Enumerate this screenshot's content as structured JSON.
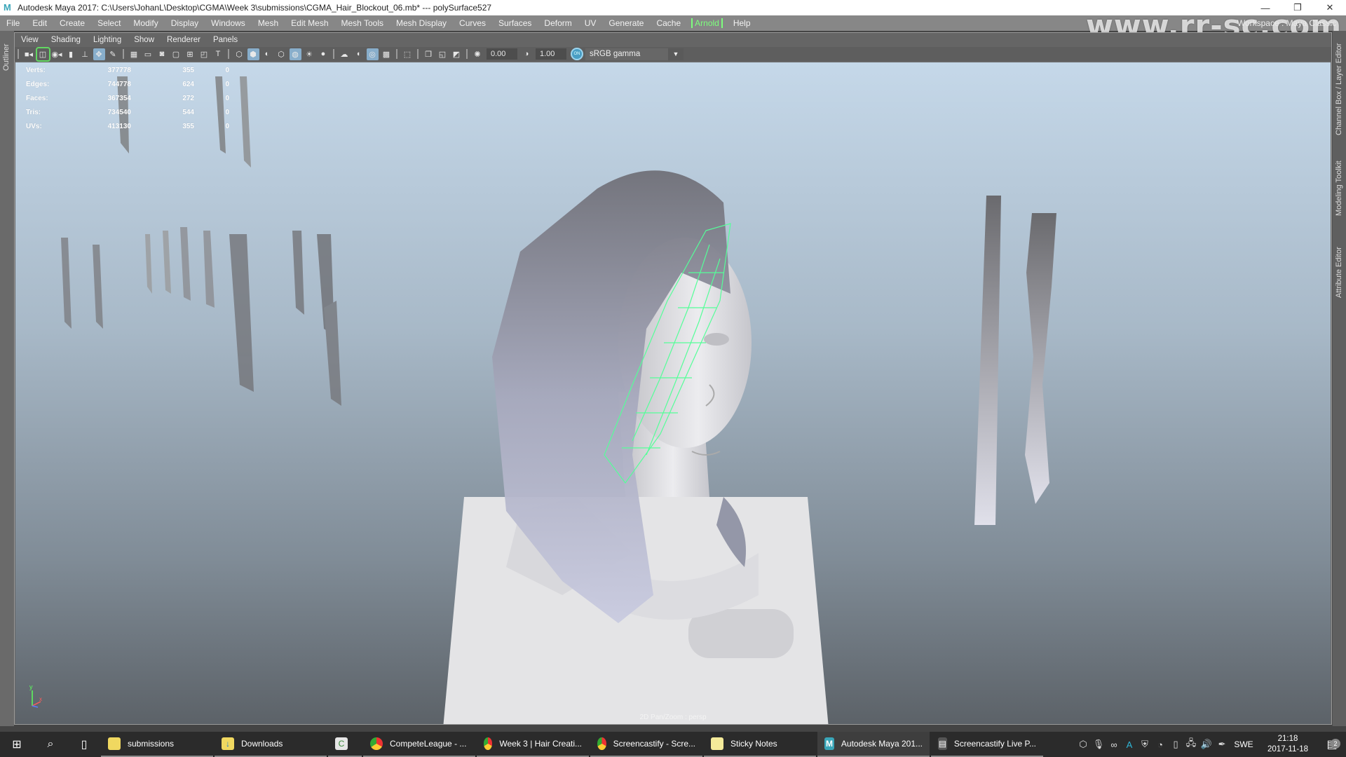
{
  "window": {
    "app_icon": "M",
    "title": "Autodesk Maya 2017: C:\\Users\\JohanL\\Desktop\\CGMA\\Week 3\\submissions\\CGMA_Hair_Blockout_06.mb*   ---   polySurface527",
    "minimize": "—",
    "maximize": "❐",
    "close": "✕"
  },
  "menubar": {
    "items": [
      "File",
      "Edit",
      "Create",
      "Select",
      "Modify",
      "Display",
      "Windows",
      "Mesh",
      "Edit Mesh",
      "Mesh Tools",
      "Mesh Display",
      "Curves",
      "Surfaces",
      "Deform",
      "UV",
      "Generate",
      "Cache",
      "Arnold",
      "Help"
    ],
    "workspace": "Workspace :  Maya Classic"
  },
  "watermark": "www.rr-sc.com",
  "side_tabs": {
    "left": "Outliner",
    "right": [
      "Channel Box / Layer Editor",
      "Modeling Toolkit",
      "Attribute Editor"
    ]
  },
  "panel_menu": [
    "View",
    "Shading",
    "Lighting",
    "Show",
    "Renderer",
    "Panels"
  ],
  "toolbar": {
    "exposure": "0.00",
    "gamma": "1.00",
    "color_management": "ON",
    "color_space": "sRGB gamma"
  },
  "hud": {
    "rows": [
      {
        "label": "Verts:",
        "total": "377778",
        "selected": "355",
        "component": "0"
      },
      {
        "label": "Edges:",
        "total": "744778",
        "selected": "624",
        "component": "0"
      },
      {
        "label": "Faces:",
        "total": "367354",
        "selected": "272",
        "component": "0"
      },
      {
        "label": "Tris:",
        "total": "734540",
        "selected": "544",
        "component": "0"
      },
      {
        "label": "UVs:",
        "total": "413130",
        "selected": "355",
        "component": "0"
      }
    ]
  },
  "viewport": {
    "camera_label": "2D Pan/Zoom : persp",
    "axis_y": "y",
    "axis_x": "x"
  },
  "taskbar": {
    "items": [
      {
        "label": "submissions",
        "icon": "folder-icon"
      },
      {
        "label": "Downloads",
        "icon": "downloads-folder-icon"
      },
      {
        "label": "",
        "icon": "camtasia-icon"
      },
      {
        "label": "CompeteLeague - ...",
        "icon": "chrome-icon"
      },
      {
        "label": "Week 3 | Hair Creati...",
        "icon": "chrome-icon"
      },
      {
        "label": "Screencastify - Scre...",
        "icon": "chrome-icon"
      },
      {
        "label": "Sticky Notes",
        "icon": "sticky-notes-icon"
      },
      {
        "label": "Autodesk Maya 201...",
        "icon": "maya-icon",
        "active": true
      },
      {
        "label": "Screencastify Live P...",
        "icon": "film-icon"
      }
    ],
    "language": "SWE",
    "time": "21:18",
    "date": "2017-11-18",
    "notifications": "2"
  }
}
